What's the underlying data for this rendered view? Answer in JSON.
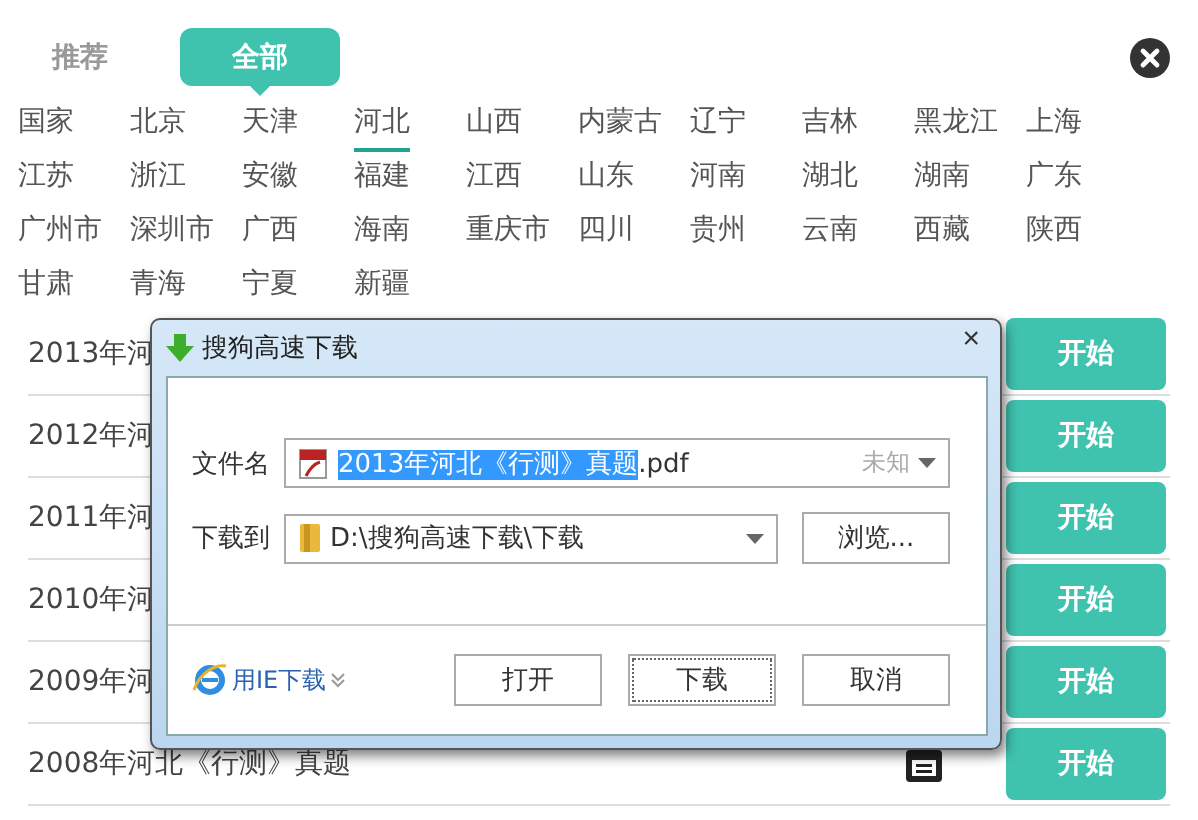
{
  "tabs": [
    {
      "label": "推荐",
      "selected": false
    },
    {
      "label": "全部",
      "selected": true
    }
  ],
  "regions": [
    {
      "label": "国家",
      "selected": false
    },
    {
      "label": "北京",
      "selected": false
    },
    {
      "label": "天津",
      "selected": false
    },
    {
      "label": "河北",
      "selected": true
    },
    {
      "label": "山西",
      "selected": false
    },
    {
      "label": "内蒙古",
      "selected": false
    },
    {
      "label": "辽宁",
      "selected": false
    },
    {
      "label": "吉林",
      "selected": false
    },
    {
      "label": "黑龙江",
      "selected": false
    },
    {
      "label": "上海",
      "selected": false
    },
    {
      "label": "江苏",
      "selected": false
    },
    {
      "label": "浙江",
      "selected": false
    },
    {
      "label": "安徽",
      "selected": false
    },
    {
      "label": "福建",
      "selected": false
    },
    {
      "label": "江西",
      "selected": false
    },
    {
      "label": "山东",
      "selected": false
    },
    {
      "label": "河南",
      "selected": false
    },
    {
      "label": "湖北",
      "selected": false
    },
    {
      "label": "湖南",
      "selected": false
    },
    {
      "label": "广东",
      "selected": false
    },
    {
      "label": "广州市",
      "selected": false
    },
    {
      "label": "深圳市",
      "selected": false
    },
    {
      "label": "广西",
      "selected": false
    },
    {
      "label": "海南",
      "selected": false
    },
    {
      "label": "重庆市",
      "selected": false
    },
    {
      "label": "四川",
      "selected": false
    },
    {
      "label": "贵州",
      "selected": false
    },
    {
      "label": "云南",
      "selected": false
    },
    {
      "label": "西藏",
      "selected": false
    },
    {
      "label": "陕西",
      "selected": false
    },
    {
      "label": "甘肃",
      "selected": false
    },
    {
      "label": "青海",
      "selected": false
    },
    {
      "label": "宁夏",
      "selected": false
    },
    {
      "label": "新疆",
      "selected": false
    }
  ],
  "papers": [
    {
      "title": "2013年河",
      "button": "开始"
    },
    {
      "title": "2012年河",
      "button": "开始"
    },
    {
      "title": "2011年河",
      "button": "开始"
    },
    {
      "title": "2010年河",
      "button": "开始"
    },
    {
      "title": "2009年河",
      "button": "开始"
    },
    {
      "title": "2008年河北《行测》真题",
      "button": "开始"
    }
  ],
  "dialog": {
    "title": "搜狗高速下载",
    "close": "×",
    "filename_label": "文件名",
    "filename_selected": "2013年河北《行测》真题",
    "filename_rest": ".pdf",
    "size": "未知",
    "dest_label": "下载到",
    "dest_value": "D:\\搜狗高速下载\\下载",
    "browse": "浏览...",
    "ie_link": "用IE下载",
    "buttons": [
      {
        "label": "打开",
        "focused": false
      },
      {
        "label": "下载",
        "focused": true
      },
      {
        "label": "取消",
        "focused": false
      }
    ]
  }
}
